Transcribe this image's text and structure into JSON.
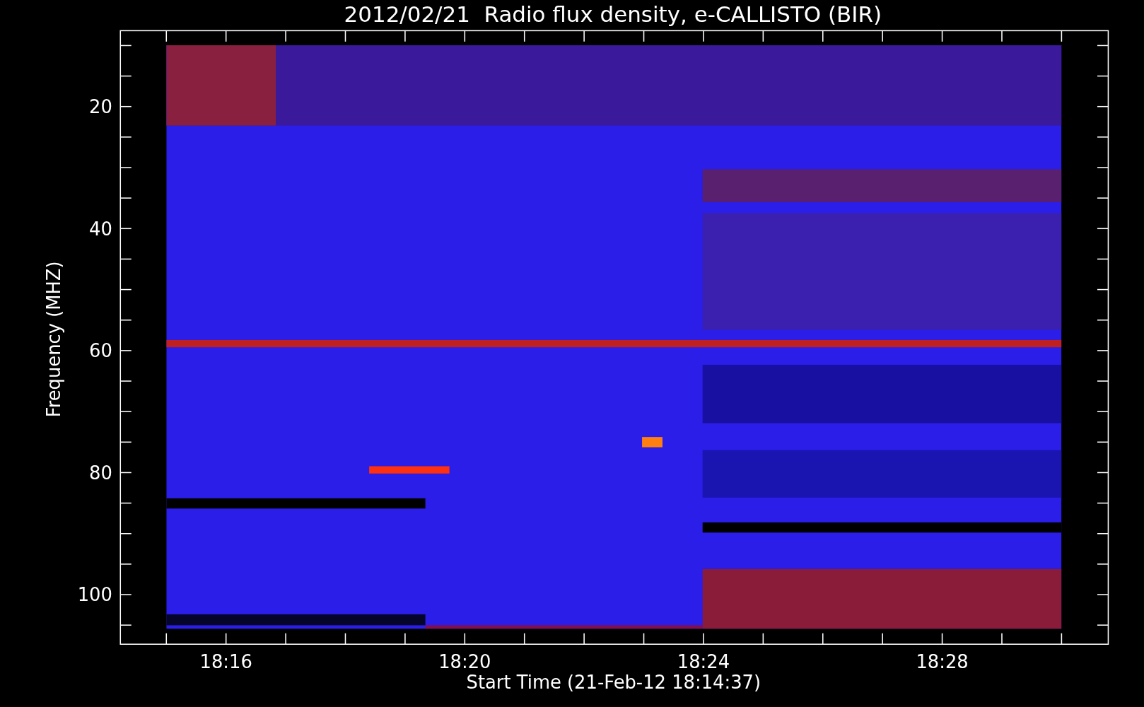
{
  "plot": {
    "title": "2012/02/21  Radio flux density, e-CALLISTO (BIR)",
    "x_axis": {
      "label": "Start Time (21-Feb-12 18:14:37)",
      "tick_labels": [
        "18:16",
        "18:20",
        "18:24",
        "18:28"
      ]
    },
    "y_axis": {
      "label": "Frequency (MHZ)",
      "tick_labels": [
        "20",
        "40",
        "60",
        "80",
        "100"
      ]
    }
  }
}
